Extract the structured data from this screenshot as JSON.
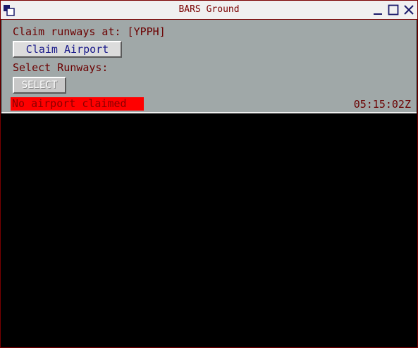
{
  "window": {
    "title": "BARS Ground",
    "colors": {
      "frame": "#7a0000",
      "panel": "#a0a8a8",
      "alert": "#ff0000"
    }
  },
  "panel": {
    "claim_label": "Claim runways at: [YPPH]",
    "claim_button": "Claim Airport",
    "select_label": "Select Runways:",
    "select_button": "SELECT"
  },
  "status": {
    "message": "No airport claimed",
    "time": "05:15:02Z"
  },
  "icons": [
    "window-menu-icon",
    "minimize-icon",
    "maximize-icon",
    "close-icon"
  ]
}
